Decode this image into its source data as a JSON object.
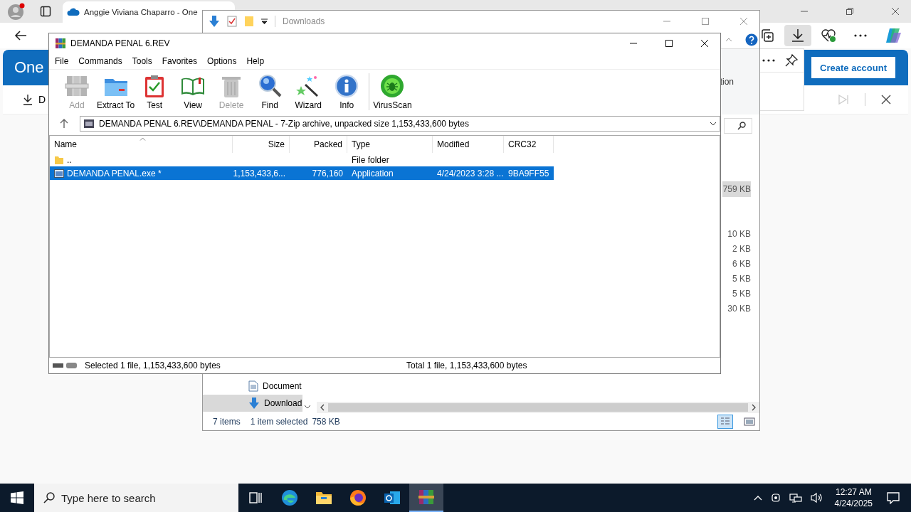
{
  "browser": {
    "tab_title": "Anggie Viviana Chaparro - One",
    "brand": "One",
    "command": "D",
    "create_account": "Create account",
    "downloads_open": true
  },
  "explorer": {
    "title": "Downloads",
    "ribbon_text": "tion",
    "size_rows": [
      {
        "size": "759 KB",
        "selected": true
      },
      {
        "size": "10 KB",
        "selected": false
      },
      {
        "size": "2 KB",
        "selected": false
      },
      {
        "size": "6 KB",
        "selected": false
      },
      {
        "size": "5 KB",
        "selected": false
      },
      {
        "size": "5 KB",
        "selected": false
      },
      {
        "size": "30 KB",
        "selected": false
      }
    ],
    "nav_items": [
      {
        "label": "Document",
        "kind": "document",
        "selected": false
      },
      {
        "label": "Download",
        "kind": "download",
        "selected": true
      }
    ],
    "status": {
      "count": "7 items",
      "selection": "1 item selected",
      "size": "758 KB"
    }
  },
  "winrar": {
    "title": "DEMANDA PENAL 6.REV",
    "menu": [
      "File",
      "Commands",
      "Tools",
      "Favorites",
      "Options",
      "Help"
    ],
    "toolbar": [
      {
        "label": "Add",
        "kind": "add",
        "disabled": true
      },
      {
        "label": "Extract To",
        "kind": "extract",
        "disabled": false
      },
      {
        "label": "Test",
        "kind": "test",
        "disabled": false
      },
      {
        "label": "View",
        "kind": "view",
        "disabled": false
      },
      {
        "label": "Delete",
        "kind": "delete",
        "disabled": true
      },
      {
        "label": "Find",
        "kind": "find",
        "disabled": false
      },
      {
        "label": "Wizard",
        "kind": "wizard",
        "disabled": false
      },
      {
        "label": "Info",
        "kind": "info",
        "disabled": false
      },
      {
        "label": "VirusScan",
        "kind": "virusscan",
        "disabled": false
      }
    ],
    "path": "DEMANDA PENAL 6.REV\\DEMANDA PENAL - 7-Zip archive, unpacked size 1,153,433,600 bytes",
    "columns": [
      "Name",
      "Size",
      "Packed",
      "Type",
      "Modified",
      "CRC32"
    ],
    "rows": [
      {
        "kind": "folder",
        "selected": false,
        "cells": [
          "..",
          "",
          "",
          "File folder",
          "",
          ""
        ]
      },
      {
        "kind": "exe",
        "selected": true,
        "cells": [
          "DEMANDA PENAL.exe *",
          "1,153,433,6...",
          "776,160",
          "Application",
          "4/24/2023 3:28 ...",
          "9BA9FF55"
        ]
      }
    ],
    "status_left": "Selected 1 file, 1,153,433,600 bytes",
    "status_right": "Total 1 file, 1,153,433,600 bytes"
  },
  "taskbar": {
    "search": {
      "placeholder": "Type here to search"
    },
    "apps": [
      {
        "kind": "task-view",
        "active": false
      },
      {
        "kind": "edge",
        "active": false
      },
      {
        "kind": "explorer",
        "active": false
      },
      {
        "kind": "firefox",
        "active": false
      },
      {
        "kind": "outlook",
        "active": false
      },
      {
        "kind": "winrar",
        "active": true
      }
    ],
    "time": "12:27 AM",
    "date": "4/24/2025"
  }
}
